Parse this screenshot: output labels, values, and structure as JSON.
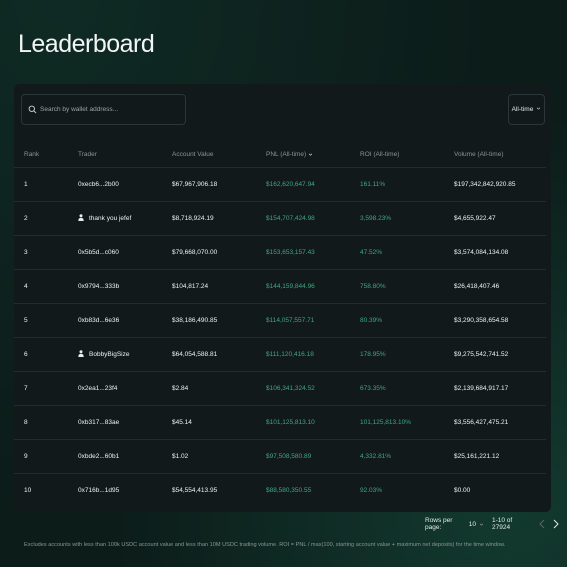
{
  "page": {
    "title": "Leaderboard"
  },
  "search": {
    "placeholder": "Search by wallet address..."
  },
  "time_range": {
    "selected": "All-time"
  },
  "table": {
    "headers": {
      "rank": "Rank",
      "trader": "Trader",
      "account_value": "Account Value",
      "pnl": "PNL (All-time)",
      "roi": "ROI (All-time)",
      "volume": "Volume (All-time)"
    },
    "rows": [
      {
        "rank": "1",
        "trader": "0xecb6...2b00",
        "named": false,
        "account_value": "$67,967,906.18",
        "pnl": "$162,620,647.94",
        "roi": "161.11%",
        "volume": "$197,342,842,920.85"
      },
      {
        "rank": "2",
        "trader": "thank you jefef",
        "named": true,
        "account_value": "$8,718,924.19",
        "pnl": "$154,707,424.98",
        "roi": "3,598.23%",
        "volume": "$4,655,922.47"
      },
      {
        "rank": "3",
        "trader": "0x5b5d...c060",
        "named": false,
        "account_value": "$79,668,070.00",
        "pnl": "$153,653,157.43",
        "roi": "47.52%",
        "volume": "$3,574,084,134.08"
      },
      {
        "rank": "4",
        "trader": "0x9794...333b",
        "named": false,
        "account_value": "$104,817.24",
        "pnl": "$144,159,844.96",
        "roi": "758.80%",
        "volume": "$26,418,407.46"
      },
      {
        "rank": "5",
        "trader": "0xb83d...6e36",
        "named": false,
        "account_value": "$38,186,490.85",
        "pnl": "$114,057,557.71",
        "roi": "80.39%",
        "volume": "$3,290,358,654.58"
      },
      {
        "rank": "6",
        "trader": "BobbyBigSize",
        "named": true,
        "account_value": "$64,054,588.81",
        "pnl": "$111,120,416.18",
        "roi": "178.95%",
        "volume": "$9,275,542,741.52"
      },
      {
        "rank": "7",
        "trader": "0x2ea1...23f4",
        "named": false,
        "account_value": "$2.84",
        "pnl": "$106,341,324.52",
        "roi": "673.35%",
        "volume": "$2,139,684,917.17"
      },
      {
        "rank": "8",
        "trader": "0xb317...83ae",
        "named": false,
        "account_value": "$45.14",
        "pnl": "$101,125,813.10",
        "roi": "101,125,813.10%",
        "volume": "$3,556,427,475.21"
      },
      {
        "rank": "9",
        "trader": "0xbde2...60b1",
        "named": false,
        "account_value": "$1.02",
        "pnl": "$97,508,580.89",
        "roi": "4,332.81%",
        "volume": "$25,161,221.12"
      },
      {
        "rank": "10",
        "trader": "0x716b...1d95",
        "named": false,
        "account_value": "$54,554,413.95",
        "pnl": "$88,580,350.55",
        "roi": "92.03%",
        "volume": "$0.00"
      }
    ]
  },
  "pagination": {
    "rows_per_page_label": "Rows per page:",
    "rows_per_page": "10",
    "range_text": "1-10 of 27924"
  },
  "footer": {
    "disclaimer": "Excludes accounts with less than 100k USDC account value and less than 10M USDC trading volume. ROI = PNL / max(100, starting account value + maximum net deposits) for the time window."
  },
  "colors": {
    "background": "#0c1c19",
    "panel": "#11191a",
    "positive": "#3fa882",
    "muted_text": "#8b9593"
  },
  "icons": [
    "search-icon",
    "chevron-down-icon",
    "sort-desc-icon",
    "user-icon",
    "chevron-left-icon",
    "chevron-right-icon"
  ]
}
